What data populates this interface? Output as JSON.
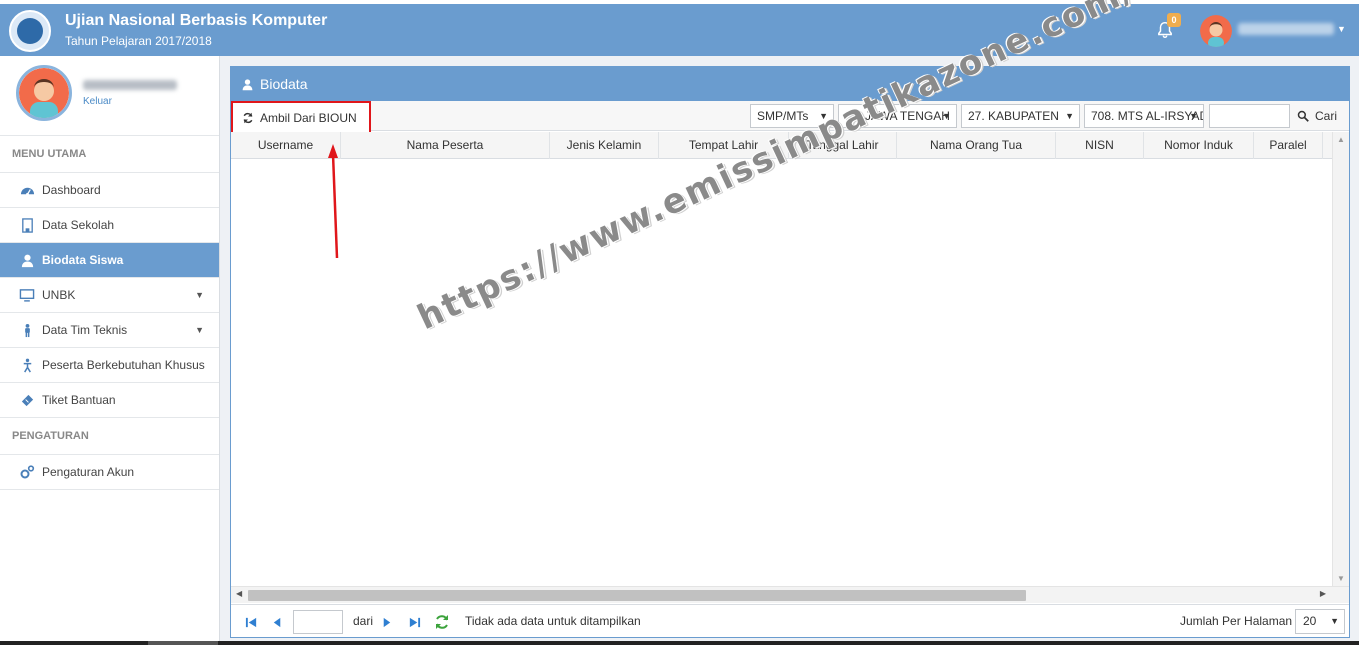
{
  "app": {
    "title": "Ujian Nasional Berbasis Komputer",
    "subtitle": "Tahun Pelajaran 2017/2018",
    "notification_count": "0"
  },
  "sidebar": {
    "logout_label": "Keluar",
    "section_main": "MENU UTAMA",
    "items": [
      {
        "label": "Dashboard",
        "icon": "dashboard-icon"
      },
      {
        "label": "Data Sekolah",
        "icon": "school-icon"
      },
      {
        "label": "Biodata Siswa",
        "icon": "user-icon",
        "active": true
      },
      {
        "label": "UNBK",
        "icon": "monitor-icon",
        "has_submenu": true
      },
      {
        "label": "Data Tim Teknis",
        "icon": "person-icon",
        "has_submenu": true
      },
      {
        "label": "Peserta Berkebutuhan Khusus",
        "icon": "accessibility-icon"
      },
      {
        "label": "Tiket Bantuan",
        "icon": "ticket-icon"
      }
    ],
    "section_settings": "PENGATURAN",
    "settings_items": [
      {
        "label": "Pengaturan Akun",
        "icon": "gears-icon"
      }
    ]
  },
  "panel": {
    "title": "Biodata",
    "ambil_button": "Ambil Dari BIOUN",
    "filters": {
      "jenjang": "SMP/MTs",
      "provinsi": "03. JAWA TENGAH",
      "kabupaten": "27. KABUPATEN",
      "sekolah": "708. MTS AL-IRSYAD"
    },
    "search_value": "",
    "search_button": "Cari",
    "columns": [
      "Username",
      "Nama Peserta",
      "Jenis Kelamin",
      "Tempat Lahir",
      "Tanggal Lahir",
      "Nama Orang Tua",
      "NISN",
      "Nomor Induk",
      "Paralel"
    ],
    "rows": []
  },
  "pager": {
    "page_value": "",
    "dari_label": "dari",
    "empty_message": "Tidak ada data untuk ditampilkan",
    "per_page_label": "Jumlah Per Halaman",
    "per_page_value": "20"
  },
  "watermark": "https://www.emissimpatikazone.com/",
  "colors": {
    "header": "#6a9ccf",
    "annotation": "#e0161b"
  }
}
